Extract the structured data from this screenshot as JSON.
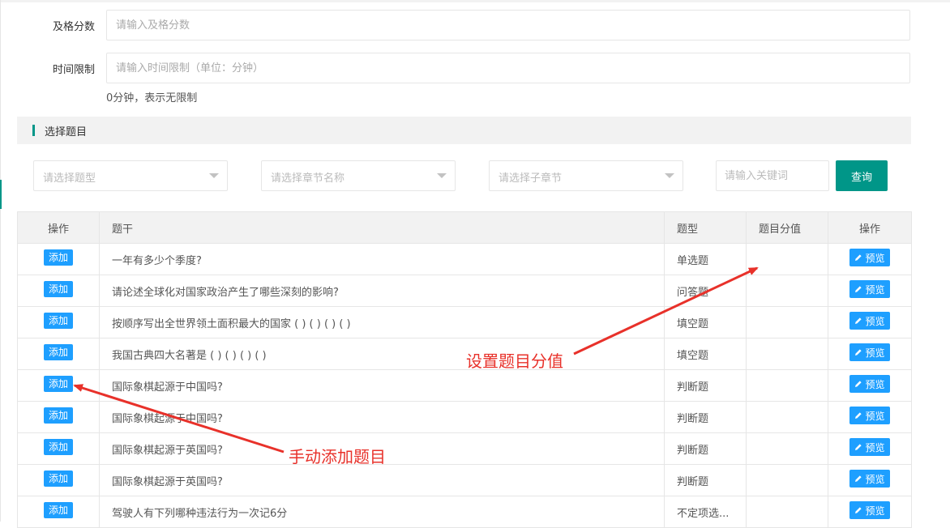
{
  "form": {
    "pass_score": {
      "label": "及格分数",
      "placeholder": "请输入及格分数"
    },
    "time_limit": {
      "label": "时间限制",
      "placeholder": "请输入时间限制（单位：分钟）",
      "hint": "0分钟，表示无限制"
    }
  },
  "section": {
    "title": "选择题目"
  },
  "filters": {
    "type_placeholder": "请选择题型",
    "chapter_placeholder": "请选择章节名称",
    "subchapter_placeholder": "请选择子章节",
    "keyword_placeholder": "请输入关键词",
    "query_label": "查询"
  },
  "table": {
    "columns": [
      "操作",
      "题干",
      "题型",
      "题目分值",
      "操作"
    ],
    "add_label": "添加",
    "preview_label": "预览",
    "rows": [
      {
        "stem": "一年有多少个季度?",
        "type": "单选题",
        "score": ""
      },
      {
        "stem": "请论述全球化对国家政治产生了哪些深刻的影响?",
        "type": "问答题",
        "score": ""
      },
      {
        "stem": "按顺序写出全世界领土面积最大的国家 ( ) ( ) ( ) ( )",
        "type": "填空题",
        "score": ""
      },
      {
        "stem": "我国古典四大名著是 ( ) ( ) ( ) ( )",
        "type": "填空题",
        "score": ""
      },
      {
        "stem": "国际象棋起源于中国吗?",
        "type": "判断题",
        "score": ""
      },
      {
        "stem": "国际象棋起源于中国吗?",
        "type": "判断题",
        "score": ""
      },
      {
        "stem": "国际象棋起源于英国吗?",
        "type": "判断题",
        "score": ""
      },
      {
        "stem": "国际象棋起源于英国吗?",
        "type": "判断题",
        "score": ""
      },
      {
        "stem": "驾驶人有下列哪种违法行为一次记6分",
        "type": "不定项选...",
        "score": ""
      }
    ]
  },
  "annotations": {
    "score_note": "设置题目分值",
    "add_note": "手动添加题目"
  },
  "colors": {
    "accent": "#009688",
    "button_blue": "#1e9fff",
    "annotation_red": "#e8312a"
  },
  "icons": {
    "preview": "pencil-icon",
    "select_caret": "caret-down-icon"
  }
}
